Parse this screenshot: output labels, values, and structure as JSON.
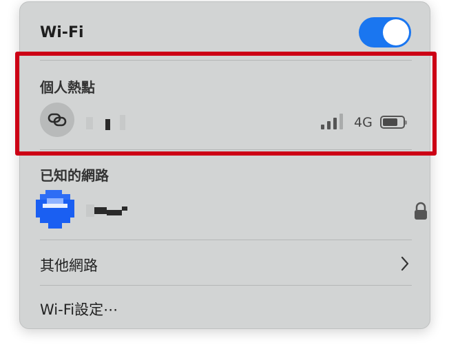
{
  "wifi": {
    "title": "Wi-Fi",
    "enabled": true,
    "accent": "#1a76f0"
  },
  "hotspot": {
    "header": "個人熱點",
    "icon": "link-icon",
    "signal_bars": 4,
    "signal_active": 3,
    "network_type": "4G",
    "battery_level": 0.7
  },
  "known": {
    "header": "已知的網路",
    "icon": "lock-icon"
  },
  "other": {
    "label": "其他網路",
    "icon": "chevron-right-icon"
  },
  "settings": {
    "label": "Wi-Fi設定⋯"
  },
  "highlight": {
    "color": "#cc0015"
  }
}
